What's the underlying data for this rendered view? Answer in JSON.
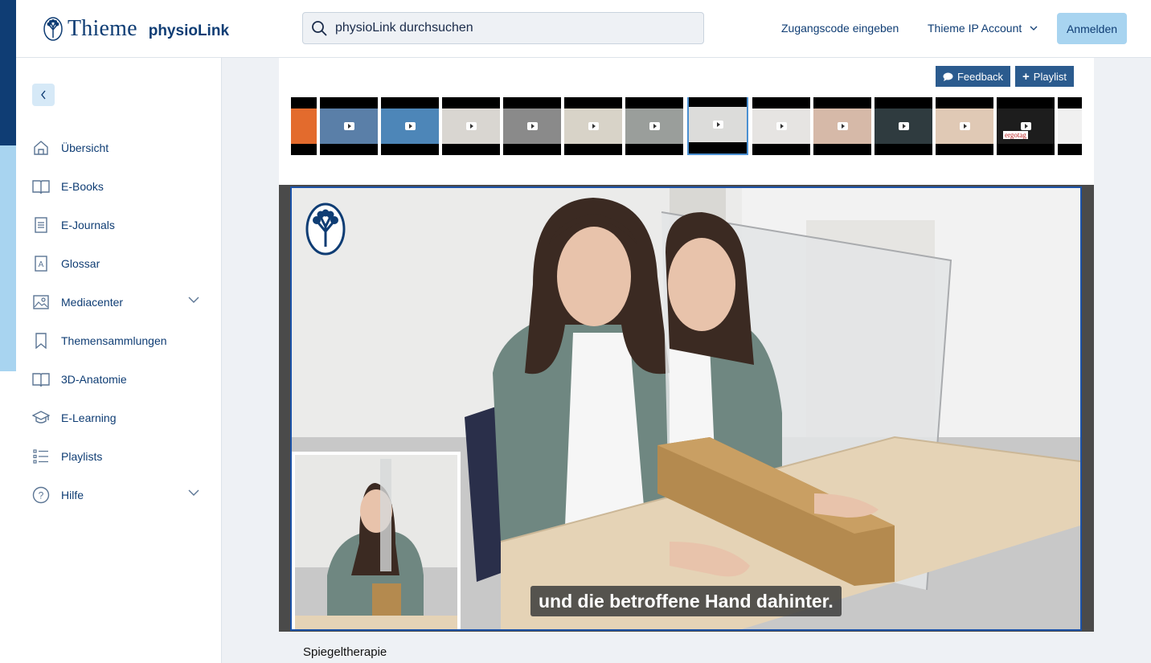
{
  "header": {
    "logo_primary": "Thieme",
    "logo_secondary": "physioLink",
    "search_placeholder": "physioLink durchsuchen",
    "access_code_link": "Zugangscode eingeben",
    "ip_account_label": "Thieme IP Account",
    "login_label": "Anmelden"
  },
  "sidebar": {
    "items": [
      {
        "label": "Übersicht",
        "icon": "home-icon",
        "expandable": false
      },
      {
        "label": "E-Books",
        "icon": "book-open-icon",
        "expandable": false
      },
      {
        "label": "E-Journals",
        "icon": "document-icon",
        "expandable": false
      },
      {
        "label": "Glossar",
        "icon": "glossary-icon",
        "expandable": false
      },
      {
        "label": "Mediacenter",
        "icon": "image-icon",
        "expandable": true
      },
      {
        "label": "Themensammlungen",
        "icon": "bookmark-icon",
        "expandable": false
      },
      {
        "label": "3D-Anatomie",
        "icon": "book-3d-icon",
        "expandable": false
      },
      {
        "label": "E-Learning",
        "icon": "graduation-cap-icon",
        "expandable": false
      },
      {
        "label": "Playlists",
        "icon": "list-icon",
        "expandable": false
      },
      {
        "label": "Hilfe",
        "icon": "help-icon",
        "expandable": true
      }
    ]
  },
  "toolbar": {
    "feedback_label": "Feedback",
    "playlist_label": "Playlist"
  },
  "thumbnails": [
    {
      "active": false,
      "play": false
    },
    {
      "active": false,
      "play": true
    },
    {
      "active": false,
      "play": true
    },
    {
      "active": false,
      "play": true
    },
    {
      "active": false,
      "play": true
    },
    {
      "active": false,
      "play": true
    },
    {
      "active": false,
      "play": true
    },
    {
      "active": true,
      "play": true
    },
    {
      "active": false,
      "play": true
    },
    {
      "active": false,
      "play": true
    },
    {
      "active": false,
      "play": true
    },
    {
      "active": false,
      "play": true
    },
    {
      "active": false,
      "play": true,
      "text": "ergotag"
    },
    {
      "active": false,
      "play": false
    }
  ],
  "video": {
    "caption": "und die betroffene Hand dahinter.",
    "title": "Spiegeltherapie"
  },
  "colors": {
    "brand_dark": "#0f3d74",
    "brand_light": "#a8d4f0",
    "button_blue": "#2b5b8e",
    "player_border": "#1b52a8"
  }
}
